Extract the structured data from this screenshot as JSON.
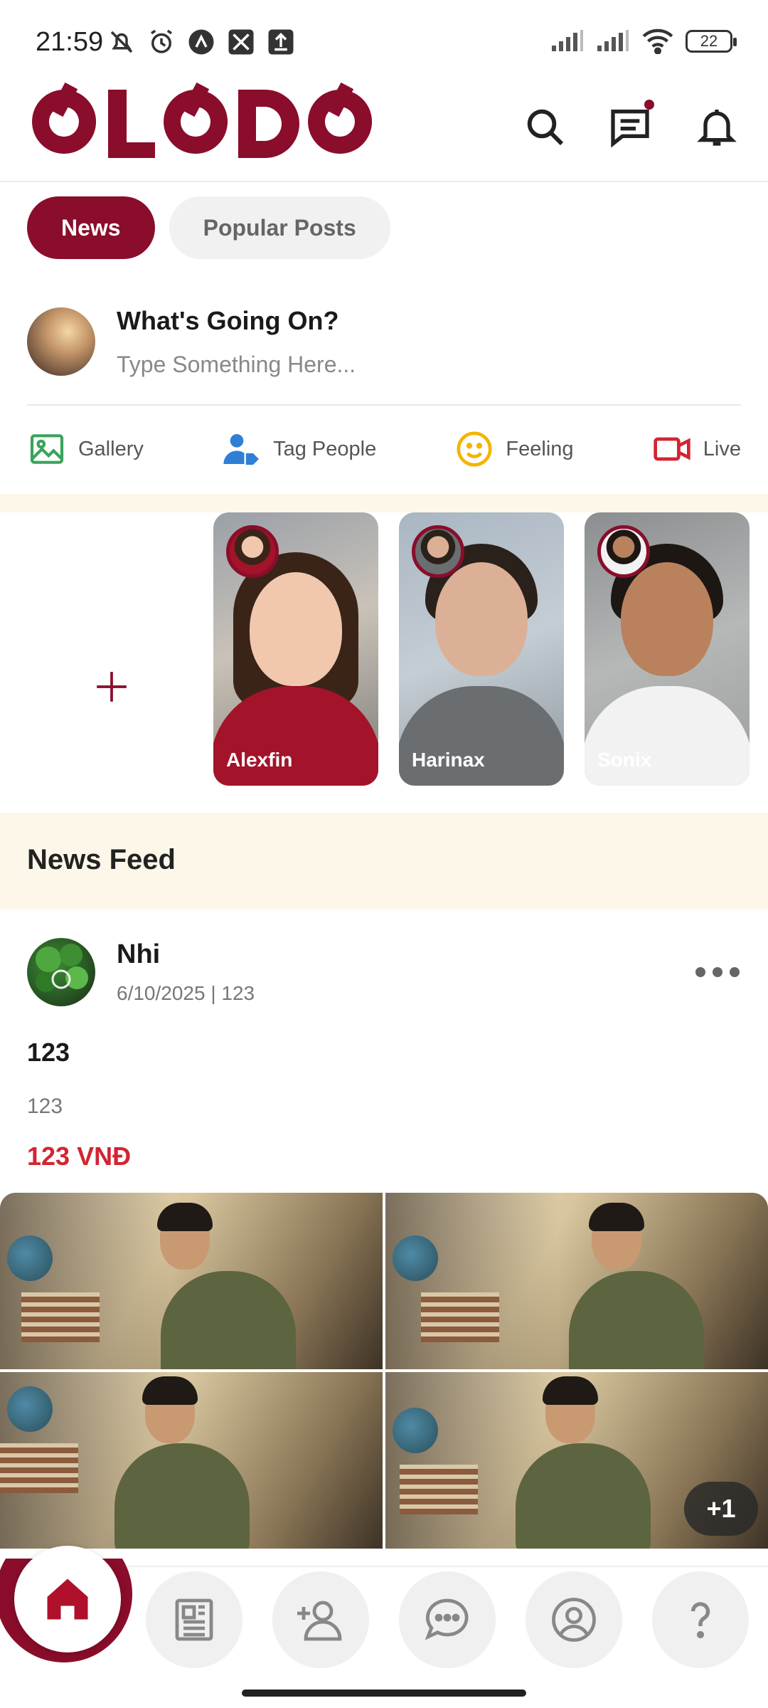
{
  "status_bar": {
    "time": "21:59",
    "battery": "22",
    "icons": [
      "mute-icon",
      "alarm-icon",
      "app-icon",
      "app-icon",
      "upload-icon",
      "signal-icon",
      "signal-icon",
      "wifi-icon",
      "battery-icon"
    ]
  },
  "header": {
    "logo_text": "OLODO",
    "icons": [
      "search-icon",
      "chat-icon",
      "bell-icon"
    ]
  },
  "tabs": [
    {
      "label": "News",
      "active": true
    },
    {
      "label": "Popular Posts",
      "active": false
    }
  ],
  "composer": {
    "title": "What's Going On?",
    "placeholder": "Type Something Here..."
  },
  "actions": [
    {
      "label": "Gallery",
      "icon": "gallery-icon",
      "color": "#3aa35a"
    },
    {
      "label": "Tag People",
      "icon": "tag-people-icon",
      "color": "#2f7fd6"
    },
    {
      "label": "Feeling",
      "icon": "smile-icon",
      "color": "#f5b400"
    },
    {
      "label": "Live",
      "icon": "video-icon",
      "color": "#d32432"
    }
  ],
  "stories": {
    "add_icon": "plus-icon",
    "items": [
      {
        "name": "Alexfin"
      },
      {
        "name": "Harinax"
      },
      {
        "name": "Sonix"
      }
    ]
  },
  "feed": {
    "title": "News Feed"
  },
  "post": {
    "author": "Nhi",
    "meta": "6/10/2025 | 123",
    "title": "123",
    "description": "123",
    "price": "123 VNĐ",
    "more_count": "+1"
  },
  "bottom_nav": {
    "items": [
      "home-icon",
      "news-icon",
      "add-friend-icon",
      "messages-icon",
      "profile-icon",
      "help-icon"
    ]
  },
  "colors": {
    "brand": "#8a0d2b",
    "price": "#d32432",
    "band": "#fdf7ea"
  }
}
